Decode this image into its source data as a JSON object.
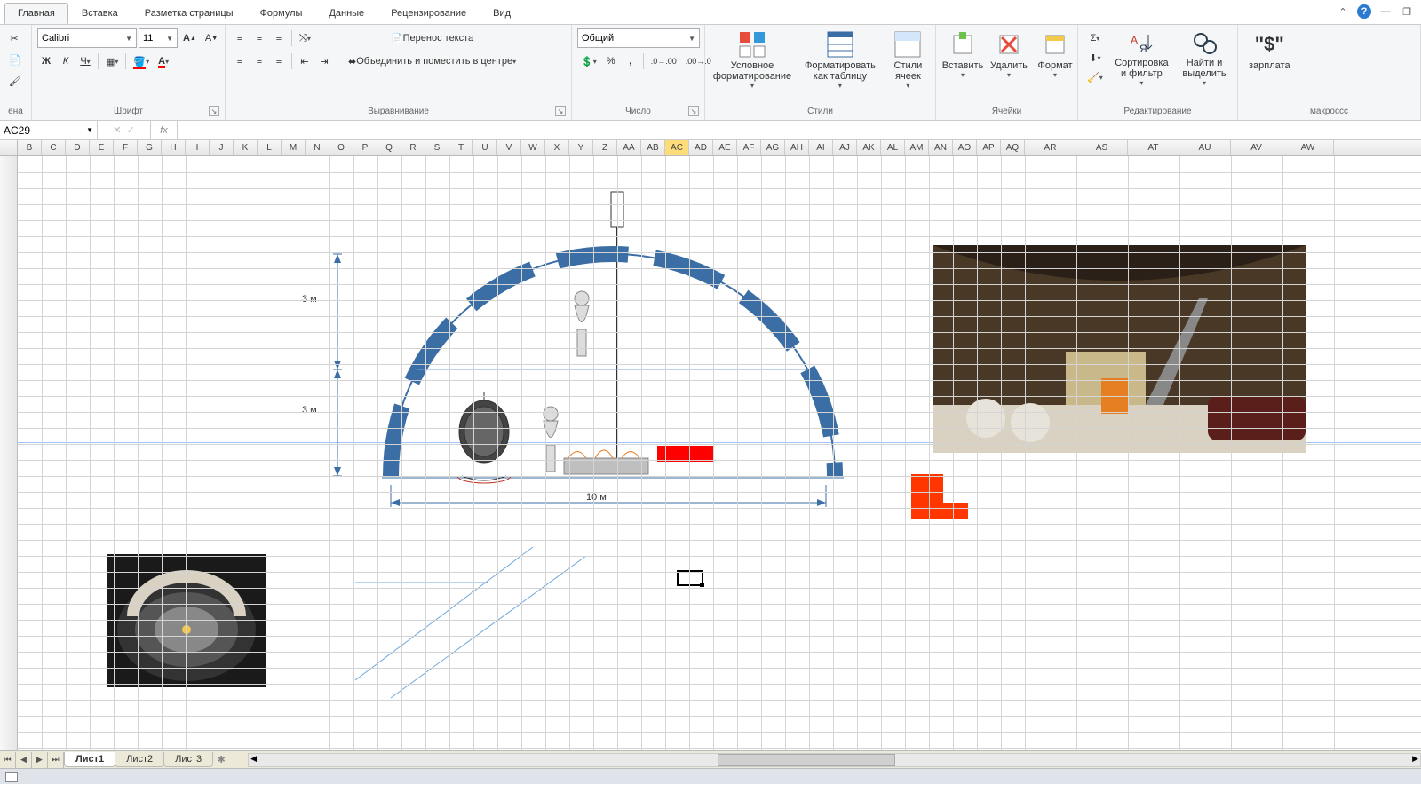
{
  "tabs": {
    "items": [
      "Главная",
      "Вставка",
      "Разметка страницы",
      "Формулы",
      "Данные",
      "Рецензирование",
      "Вид"
    ],
    "active_index": 0
  },
  "clipboard": {
    "label": "ена"
  },
  "font": {
    "group_label": "Шрифт",
    "family": "Calibri",
    "size": "11",
    "bold": "Ж",
    "italic": "К",
    "underline": "Ч"
  },
  "alignment": {
    "group_label": "Выравнивание",
    "wrap": "Перенос текста",
    "merge": "Объединить и поместить в центре"
  },
  "number": {
    "group_label": "Число",
    "format": "Общий"
  },
  "styles": {
    "group_label": "Стили",
    "conditional": "Условное форматирование",
    "as_table": "Форматировать как таблицу",
    "cell_styles": "Стили ячеек"
  },
  "cells": {
    "group_label": "Ячейки",
    "insert": "Вставить",
    "delete": "Удалить",
    "format": "Формат"
  },
  "editing": {
    "group_label": "Редактирование",
    "sort_filter": "Сортировка и фильтр",
    "find_select": "Найти и выделить"
  },
  "macros": {
    "group_label": "макроссс",
    "salary": "зарплата"
  },
  "name_box": "AC29",
  "columns": [
    "B",
    "C",
    "D",
    "E",
    "F",
    "G",
    "H",
    "I",
    "J",
    "K",
    "L",
    "M",
    "N",
    "O",
    "P",
    "Q",
    "R",
    "S",
    "T",
    "U",
    "V",
    "W",
    "X",
    "Y",
    "Z",
    "AA",
    "AB",
    "AC",
    "AD",
    "AE",
    "AF",
    "AG",
    "AH",
    "AI",
    "AJ",
    "AK",
    "AL",
    "AM",
    "AN",
    "AO",
    "AP",
    "AQ",
    "AR",
    "AS",
    "AT",
    "AU",
    "AV",
    "AW"
  ],
  "selected_column": "AC",
  "sheets": {
    "items": [
      "Лист1",
      "Лист2",
      "Лист3"
    ],
    "active_index": 0
  },
  "drawing": {
    "dim_height1": "3 м",
    "dim_height2": "3 м",
    "dim_width": "10 м"
  },
  "colors": {
    "accent_blue": "#3b6ea5",
    "excel_red": "#ff0000",
    "orange": "#ff3600",
    "tab_highlight": "#fddc7a"
  }
}
